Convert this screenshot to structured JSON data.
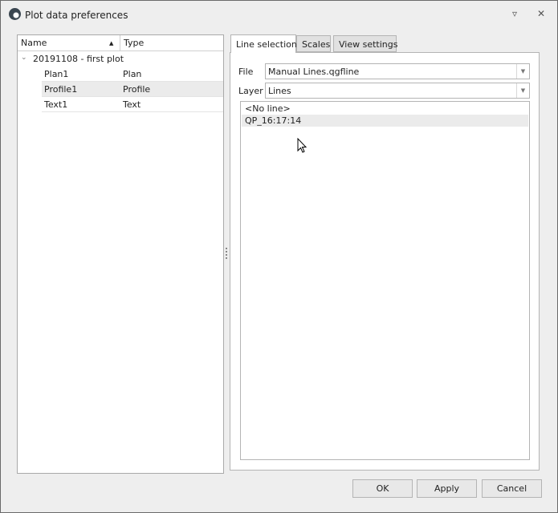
{
  "window": {
    "title": "Plot data preferences",
    "pin_icon": "pin-icon",
    "close_icon": "close-icon"
  },
  "tree": {
    "columns": {
      "name": "Name",
      "type": "Type",
      "sort": "ascending"
    },
    "root": {
      "label": "20191108 - first plot",
      "expanded": true
    },
    "items": [
      {
        "name": "Plan1",
        "type": "Plan"
      },
      {
        "name": "Profile1",
        "type": "Profile",
        "selected": true
      },
      {
        "name": "Text1",
        "type": "Text"
      }
    ]
  },
  "tabs": [
    {
      "label": "Line selection",
      "active": true
    },
    {
      "label": "Scales"
    },
    {
      "label": "View settings"
    }
  ],
  "line_selection": {
    "file_label": "File",
    "file_value": "Manual Lines.qgfline",
    "layer_label": "Layer",
    "layer_value": "Lines",
    "lines": [
      {
        "label": "<No line>"
      },
      {
        "label": "QP_16:17:14",
        "selected": true
      }
    ]
  },
  "buttons": {
    "ok": "OK",
    "apply": "Apply",
    "cancel": "Cancel"
  }
}
